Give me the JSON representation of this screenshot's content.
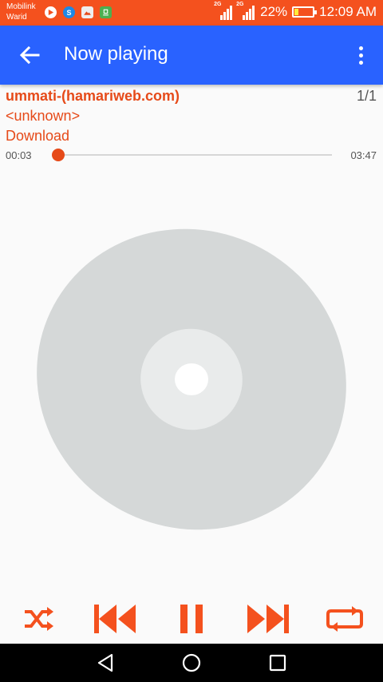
{
  "status_bar": {
    "carrier_line1": "Mobilink",
    "carrier_line2": "Warid",
    "network_1": "2G",
    "network_2": "2G",
    "battery_percent": "22%",
    "battery_level": 0.22,
    "time": "12:09 AM",
    "notification_icons": [
      "play-icon",
      "s-icon",
      "gallery-icon",
      "download-icon"
    ],
    "bg_color": "#f4511e"
  },
  "app_bar": {
    "title": "Now playing",
    "bg_color": "#2962ff"
  },
  "track": {
    "title": "ummati-(hamariweb.com)",
    "artist": "<unknown>",
    "queue_position": "1/1",
    "download_label": "Download",
    "elapsed": "00:03",
    "duration": "03:47",
    "progress": 0.013,
    "accent_color": "#e64a19"
  },
  "controls": [
    "shuffle-icon",
    "previous-icon",
    "pause-icon",
    "next-icon",
    "repeat-icon"
  ],
  "nav_bar": [
    "back-icon",
    "home-icon",
    "recents-icon"
  ]
}
